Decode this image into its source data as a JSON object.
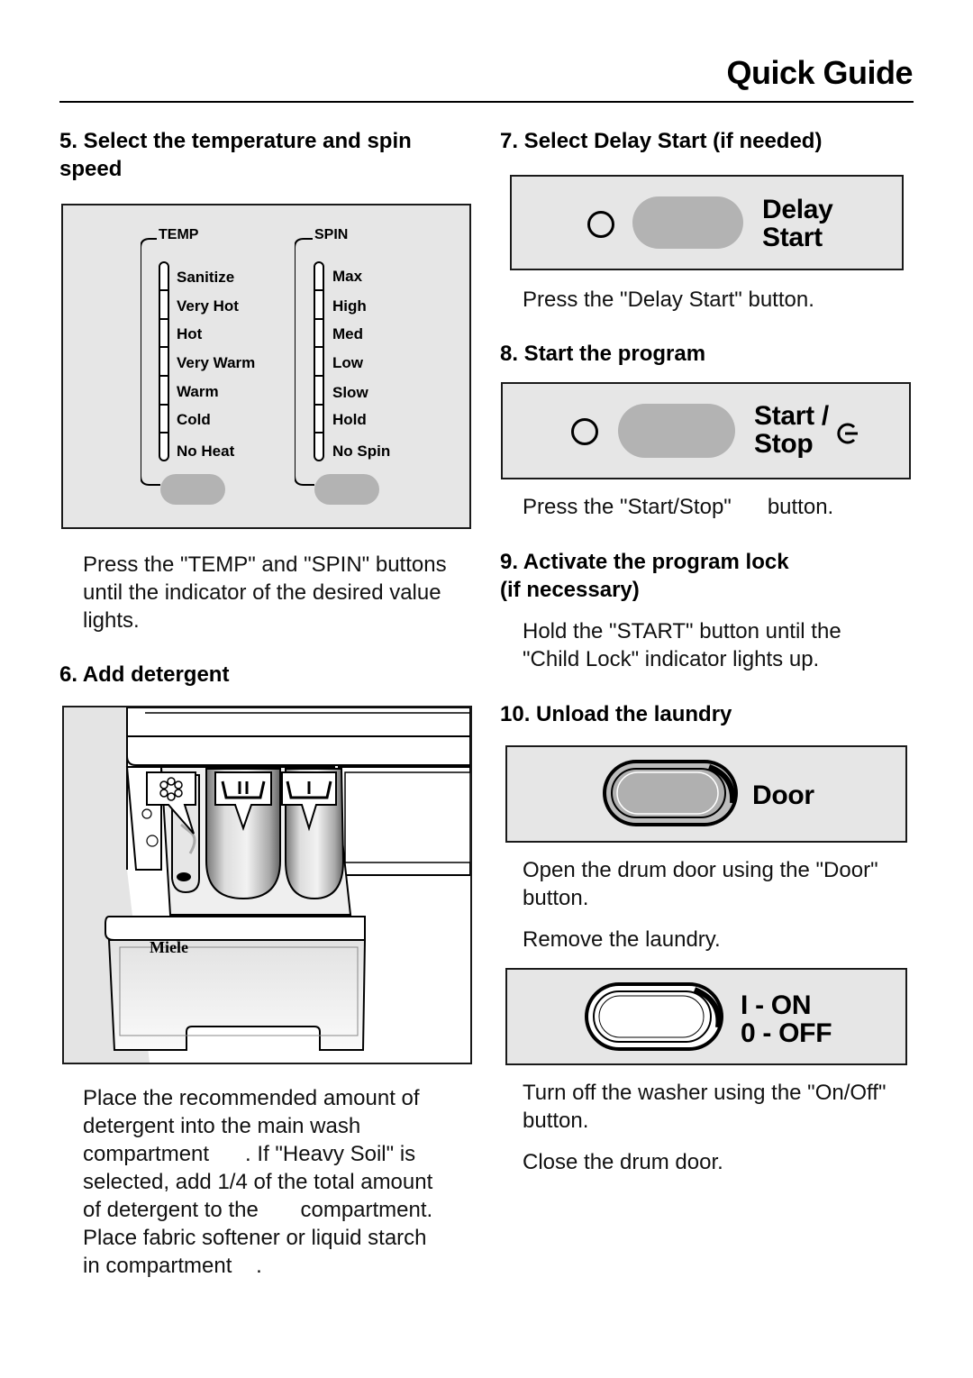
{
  "header": {
    "title": "Quick Guide"
  },
  "step5": {
    "heading_line1": "5. Select the temperature and spin",
    "heading_line2": "speed",
    "temp": {
      "title": "TEMP",
      "options": [
        "Sanitize",
        "Very Hot",
        "Hot",
        "Very Warm",
        "Warm",
        "Cold",
        "No Heat"
      ]
    },
    "spin": {
      "title": "SPIN",
      "options": [
        "Max",
        "High",
        "Med",
        "Low",
        "Slow",
        "Hold",
        "No Spin"
      ]
    },
    "text_lines": [
      "Press the \"TEMP\" and \"SPIN\" buttons",
      "until the indicator of the desired value",
      "lights."
    ]
  },
  "step6": {
    "heading": "6. Add detergent",
    "brand": "Miele",
    "compartment_icons": [
      "flower-icon",
      "prewash-II-icon",
      "mainwash-I-icon"
    ],
    "text_lines": [
      "Place the recommended amount of",
      "detergent into the main wash",
      "compartment      . If \"Heavy Soil\" is",
      "selected, add 1/4 of the total amount",
      "of detergent to the       compartment.",
      "Place fabric softener or liquid starch",
      "in compartment    ."
    ]
  },
  "step7": {
    "heading": "7. Select Delay Start (if needed)",
    "button_label_line1": "Delay",
    "button_label_line2": "Start",
    "text": "Press the \"Delay Start\" button."
  },
  "step8": {
    "heading": "8. Start the program",
    "button_label_line1": "Start /",
    "button_label_line2": "Stop",
    "text": "Press the \"Start/Stop\"      button."
  },
  "step9": {
    "heading_line1": "9. Activate the program lock",
    "heading_line2": "(if necessary)",
    "text_lines": [
      "Hold the \"START\" button until the",
      "\"Child Lock\" indicator lights up."
    ]
  },
  "step10": {
    "heading": "10. Unload the laundry",
    "door_label": "Door",
    "text1_lines": [
      "Open the drum door using the \"Door\"",
      "button."
    ],
    "text2": "Remove the laundry.",
    "power_label_line1": "I - ON",
    "power_label_line2": "0 - OFF",
    "text3_lines": [
      "Turn off the washer using the \"On/Off\"",
      "button."
    ],
    "text4": "Close the drum door."
  }
}
